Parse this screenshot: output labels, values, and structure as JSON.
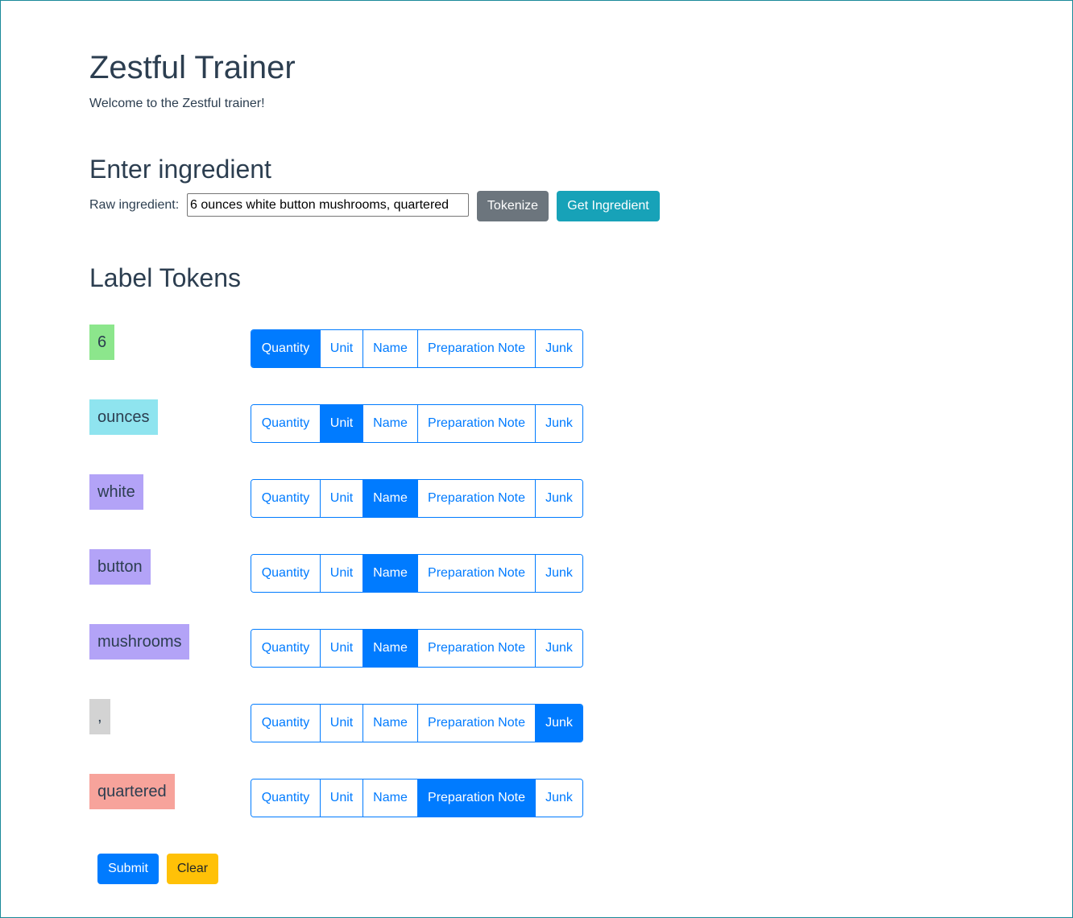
{
  "header": {
    "title": "Zestful Trainer",
    "welcome": "Welcome to the Zestful trainer!"
  },
  "enter": {
    "heading": "Enter ingredient",
    "raw_label": "Raw ingredient:",
    "raw_value": "6 ounces white button mushrooms, quartered",
    "tokenize_label": "Tokenize",
    "get_label": "Get Ingredient"
  },
  "label_section": {
    "heading": "Label Tokens"
  },
  "label_options": [
    "Quantity",
    "Unit",
    "Name",
    "Preparation Note",
    "Junk"
  ],
  "label_colors": {
    "Quantity": "#8ce68c",
    "Unit": "#8fe4ef",
    "Name": "#b3a3f7",
    "Preparation Note": "#f7a39b",
    "Junk": "#d3d3d3"
  },
  "tokens": [
    {
      "text": "6",
      "label": "Quantity"
    },
    {
      "text": "ounces",
      "label": "Unit"
    },
    {
      "text": "white",
      "label": "Name"
    },
    {
      "text": "button",
      "label": "Name"
    },
    {
      "text": "mushrooms",
      "label": "Name"
    },
    {
      "text": ",",
      "label": "Junk"
    },
    {
      "text": "quartered",
      "label": "Preparation Note"
    }
  ],
  "actions": {
    "submit_label": "Submit",
    "clear_label": "Clear"
  }
}
